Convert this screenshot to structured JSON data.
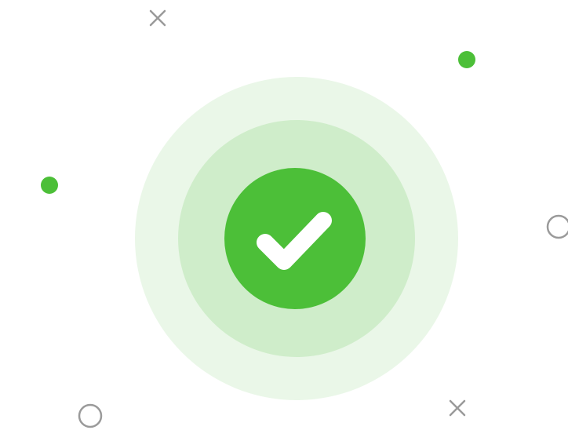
{
  "illustration": {
    "semantic": "success-confirmation",
    "main_icon": "checkmark-icon",
    "decorations": [
      "cross-icon",
      "dot-icon",
      "ring-icon"
    ]
  },
  "colors": {
    "background": "#ffffff",
    "outer_ring": "#eaf7e8",
    "middle_ring": "#cfedca",
    "inner_circle": "#4cbf38",
    "check": "#ffffff",
    "dot": "#4cbf38",
    "cross": "#9a9a9a",
    "outline_ring": "#9a9a9a"
  }
}
